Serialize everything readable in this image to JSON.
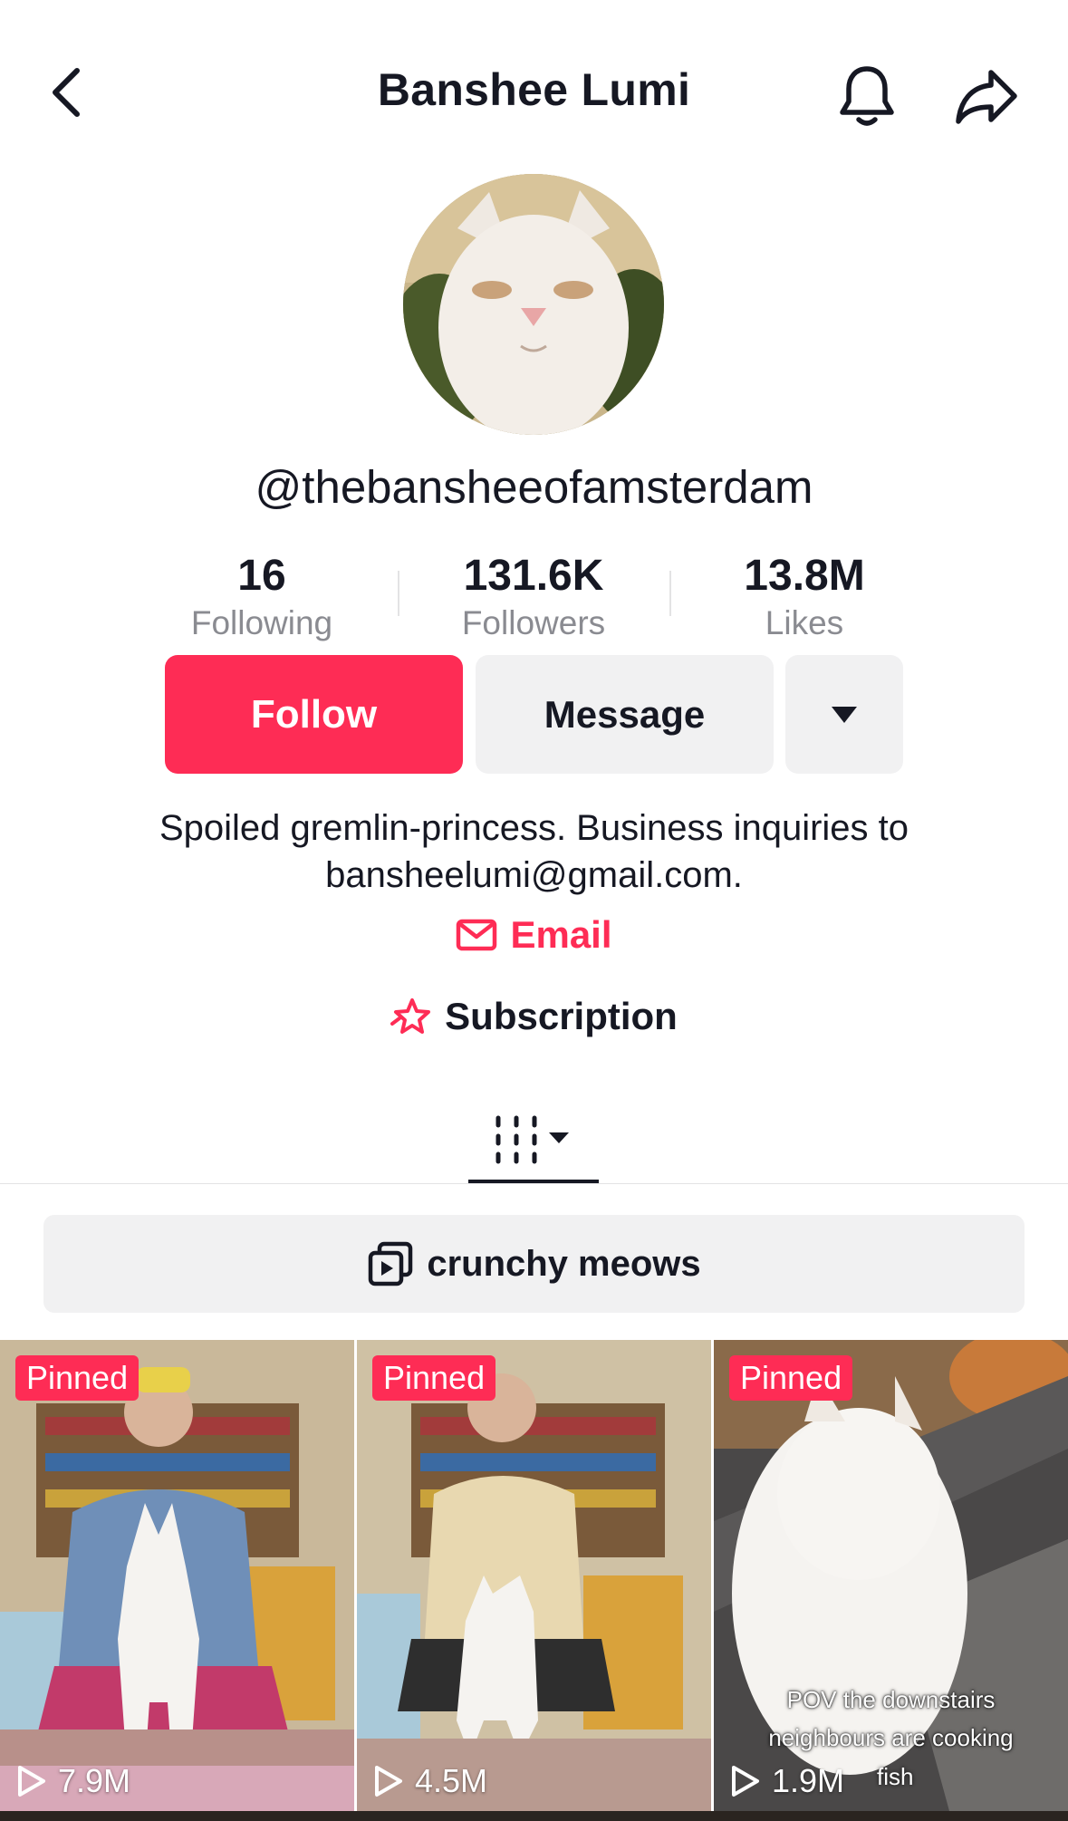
{
  "header": {
    "title": "Banshee Lumi"
  },
  "profile": {
    "username": "@thebansheeofamsterdam",
    "stats": [
      {
        "value": "16",
        "label": "Following"
      },
      {
        "value": "131.6K",
        "label": "Followers"
      },
      {
        "value": "13.8M",
        "label": "Likes"
      }
    ]
  },
  "actions": {
    "follow_label": "Follow",
    "message_label": "Message"
  },
  "bio": {
    "line1": "Spoiled gremlin-princess. Business inquiries to",
    "line2": "bansheelumi@gmail.com.",
    "email_label": "Email",
    "subscription_label": "Subscription"
  },
  "playlist": {
    "label": "crunchy meows"
  },
  "videos": [
    {
      "badge": "Pinned",
      "views": "7.9M",
      "caption": ""
    },
    {
      "badge": "Pinned",
      "views": "4.5M",
      "caption": ""
    },
    {
      "badge": "Pinned",
      "views": "1.9M",
      "caption_lines": [
        "POV the downstairs",
        "neighbours are cooking"
      ],
      "caption_tail": "fish"
    }
  ],
  "colors": {
    "accent": "#fe2c55",
    "text": "#161823",
    "secondary_text": "#8a8b91",
    "button_bg": "#f1f1f2"
  },
  "icons": {
    "back": "chevron-left-icon",
    "bell": "bell-icon",
    "share": "share-arrow-icon",
    "more": "caret-down-icon",
    "email": "envelope-icon",
    "subscription": "star-badge-icon",
    "grid": "grid-columns-icon",
    "playlist": "playlist-icon",
    "views": "play-icon"
  }
}
